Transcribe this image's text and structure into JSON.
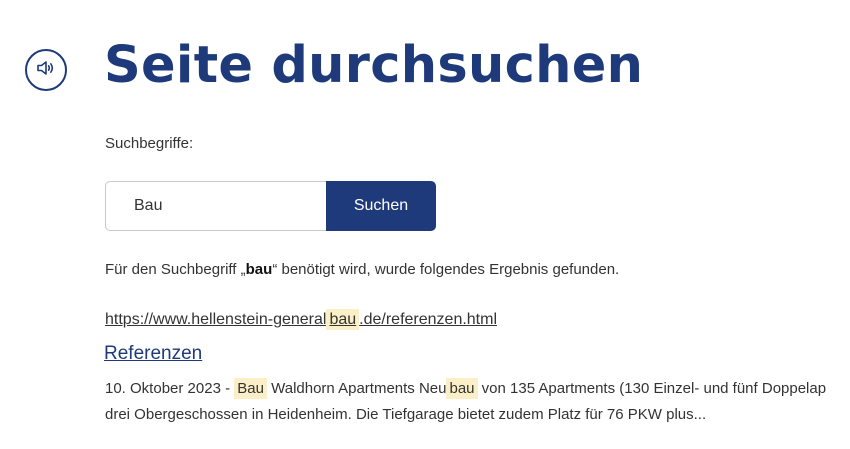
{
  "header": {
    "title": "Seite durchsuchen",
    "speaker_icon": "speaker-icon"
  },
  "search": {
    "label": "Suchbegriffe:",
    "value": "Bau",
    "button_label": "Suchen"
  },
  "summary": {
    "prefix": "Für den Suchbegriff „",
    "term": "bau",
    "suffix": "“ benötigt wird, wurde folgendes Ergebnis gefunden."
  },
  "result": {
    "url_before": "https://www.hellenstein-general",
    "url_highlight": "bau",
    "url_after": ".de/referenzen.html",
    "title": "Referenzen",
    "snippet_date": "10. Oktober 2023 - ",
    "snippet_hl1": "Bau",
    "snippet_mid": " Waldhorn Apartments Neu",
    "snippet_hl2": "bau",
    "snippet_line1_end": " von 135 Apartments (130 Einzel- und fünf Doppelap",
    "snippet_line2": "drei Obergeschossen in Heidenheim. Die Tiefgarage bietet zudem Platz für 76 PKW plus..."
  },
  "colors": {
    "brand": "#1e3a7b",
    "highlight": "#fbefc8"
  }
}
